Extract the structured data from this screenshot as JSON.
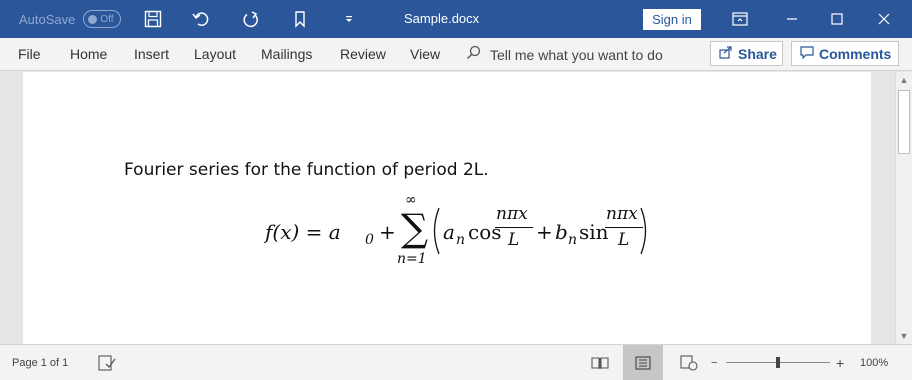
{
  "titlebar": {
    "autosave_label": "AutoSave",
    "autosave_state": "Off",
    "document_title": "Sample.docx",
    "signin_label": "Sign in",
    "icons": [
      "save-icon",
      "undo-icon",
      "redo-icon",
      "touch-mode-icon",
      "customize-qat-icon",
      "ribbon-display-icon",
      "minimize-icon",
      "maximize-icon",
      "close-icon"
    ]
  },
  "ribbon": {
    "tabs": [
      "File",
      "Home",
      "Insert",
      "Layout",
      "Mailings",
      "Review",
      "View"
    ],
    "tell_me_placeholder": "Tell me what you want to do",
    "share_label": "Share",
    "comments_label": "Comments"
  },
  "document": {
    "caption": "Fourier series for the function of period 2L.",
    "equation": {
      "lhs": "f(x) = a",
      "a_sub": "0",
      "plus": "+",
      "sum_symbol": "∑",
      "sum_upper": "∞",
      "sum_lower": "n=1",
      "a_n": "a",
      "n_sub": "n",
      "cos": "cos",
      "numerator": "nπx",
      "denominator": "L",
      "b_n": "b",
      "sin": "sin"
    }
  },
  "statusbar": {
    "page_info": "Page 1 of 1",
    "zoom_minus": "−",
    "zoom_plus": "+",
    "zoom_level": "100%",
    "zoom_value": 0.5
  },
  "colors": {
    "brand": "#2b579a",
    "titlebar_text": "#ffffff"
  }
}
